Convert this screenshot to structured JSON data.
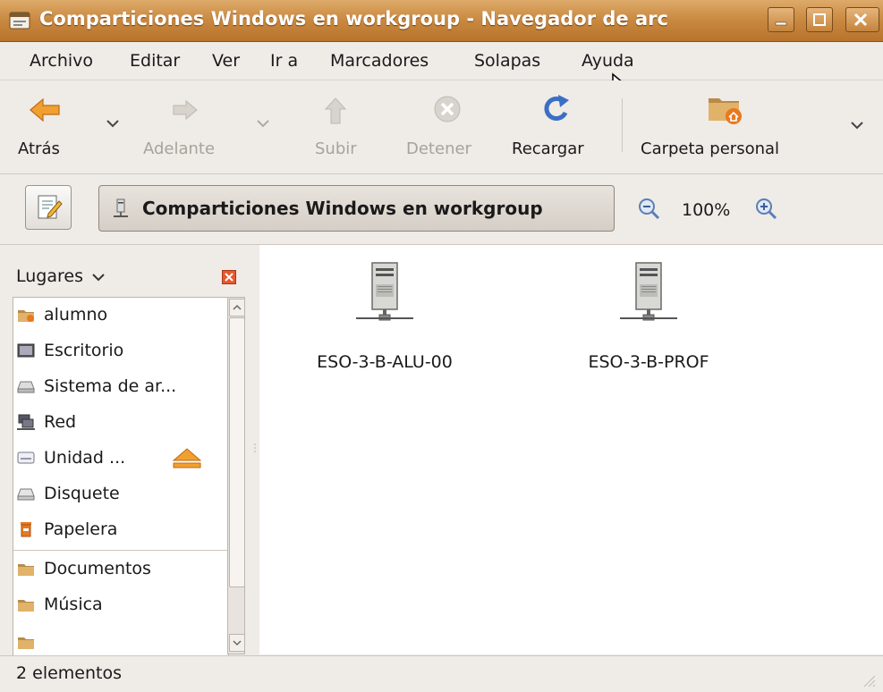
{
  "window": {
    "title": "Comparticiones Windows en workgroup - Navegador de arc"
  },
  "menubar": {
    "items": [
      "Archivo",
      "Editar",
      "Ver",
      "Ir a",
      "Marcadores",
      "Solapas",
      "Ayuda"
    ]
  },
  "toolbar": {
    "back": "Atrás",
    "forward": "Adelante",
    "up": "Subir",
    "stop": "Detener",
    "reload": "Recargar",
    "home": "Carpeta personal"
  },
  "location": {
    "path": "Comparticiones Windows en workgroup",
    "zoom": "100%"
  },
  "sidebar": {
    "header": "Lugares",
    "items": [
      {
        "label": "alumno",
        "icon": "home-folder-icon"
      },
      {
        "label": "Escritorio",
        "icon": "desktop-icon"
      },
      {
        "label": "Sistema de ar...",
        "icon": "drive-icon"
      },
      {
        "label": "Red",
        "icon": "network-icon"
      },
      {
        "label": "Unidad ...",
        "icon": "cdrom-icon"
      },
      {
        "label": "Disquete",
        "icon": "floppy-icon"
      },
      {
        "label": "Papelera",
        "icon": "trash-icon"
      },
      {
        "label": "Documentos",
        "icon": "folder-icon"
      },
      {
        "label": "Música",
        "icon": "folder-icon"
      }
    ]
  },
  "content": {
    "items": [
      {
        "label": "ESO-3-B-ALU-00",
        "icon": "server-icon"
      },
      {
        "label": "ESO-3-B-PROF",
        "icon": "server-icon"
      }
    ]
  },
  "status": {
    "text": "2 elementos"
  },
  "colors": {
    "titlebar": "#c9883f",
    "background": "#efebe7",
    "content_bg": "#ffffff",
    "accent_orange": "#e8791f"
  }
}
